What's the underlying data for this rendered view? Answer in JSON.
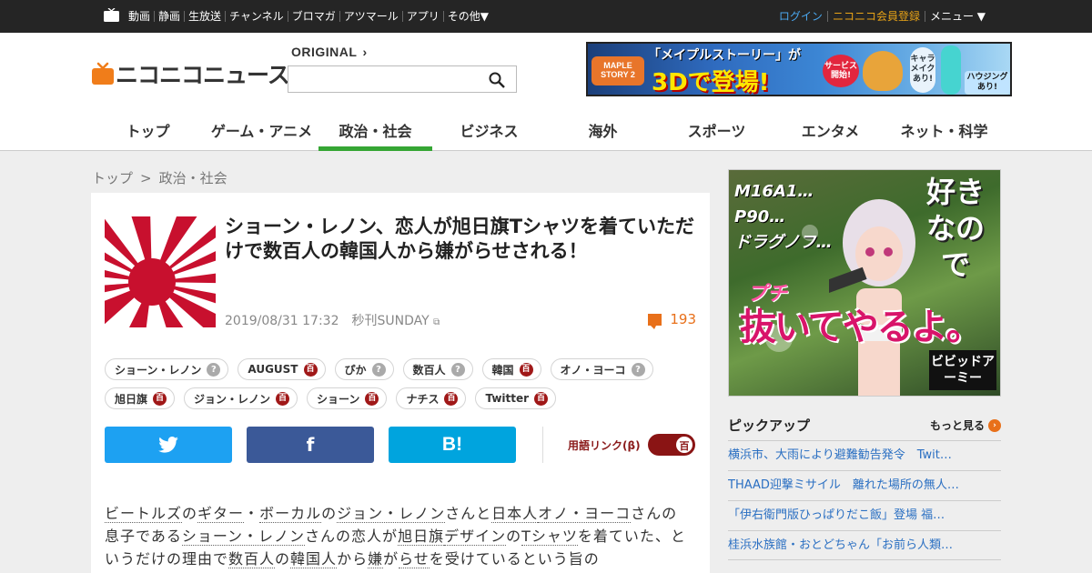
{
  "topbar": {
    "nav": [
      "動画",
      "静画",
      "生放送",
      "チャンネル",
      "ブロマガ",
      "アツマール",
      "アプリ",
      "その他▼"
    ],
    "login": "ログイン",
    "register": "ニコニコ会員登録",
    "menu": "メニュー ▼"
  },
  "header": {
    "logo_text": "ニコニコニュース",
    "original_label": "ORIGINAL",
    "search_value": ""
  },
  "ad_top": {
    "logo": "MAPLE STORY 2",
    "line1": "「メイプルストーリー」が",
    "line2": "3Dで登場!",
    "service": "サービス開始!",
    "chara": "キャラメイクあり!",
    "housing": "ハウジングあり!"
  },
  "nav": [
    {
      "label": "トップ",
      "active": false
    },
    {
      "label": "ゲーム・アニメ",
      "active": false
    },
    {
      "label": "政治・社会",
      "active": true
    },
    {
      "label": "ビジネス",
      "active": false
    },
    {
      "label": "海外",
      "active": false
    },
    {
      "label": "スポーツ",
      "active": false
    },
    {
      "label": "エンタメ",
      "active": false
    },
    {
      "label": "ネット・科学",
      "active": false
    }
  ],
  "breadcrumb": {
    "home": "トップ",
    "sep": ">",
    "current": "政治・社会"
  },
  "article": {
    "title": "ショーン・レノン、恋人が旭日旗Tシャツを着ていただけで数百人の韓国人から嫌がらせされる！",
    "date": "2019/08/31 17:32",
    "source": "秒刊SUNDAY",
    "comment_count": "193",
    "tags": [
      {
        "label": "ショーン・レノン",
        "type": "q"
      },
      {
        "label": "AUGUST",
        "type": "h"
      },
      {
        "label": "ぴか",
        "type": "q"
      },
      {
        "label": "数百人",
        "type": "q"
      },
      {
        "label": "韓国",
        "type": "h"
      },
      {
        "label": "オノ・ヨーコ",
        "type": "q"
      },
      {
        "label": "旭日旗",
        "type": "h"
      },
      {
        "label": "ジョン・レノン",
        "type": "h"
      },
      {
        "label": "ショーン",
        "type": "h"
      },
      {
        "label": "ナチス",
        "type": "h"
      },
      {
        "label": "Twitter",
        "type": "h"
      }
    ],
    "tag_q_icon": "?",
    "tag_h_icon": "百",
    "share": {
      "twitter": "twitter-icon",
      "facebook": "f",
      "hatena": "B!"
    },
    "term_link_label": "用語リンク(β)",
    "term_toggle": "百",
    "body_segments": [
      {
        "t": "ビートルズ",
        "k": true
      },
      {
        "t": "の",
        "k": false
      },
      {
        "t": "ギター",
        "k": true
      },
      {
        "t": "・",
        "k": false
      },
      {
        "t": "ボーカル",
        "k": true
      },
      {
        "t": "の",
        "k": false
      },
      {
        "t": "ジョン・レノン",
        "k": true
      },
      {
        "t": "さんと",
        "k": false
      },
      {
        "t": "日本人",
        "k": true
      },
      {
        "t": "オノ・ヨーコ",
        "k": true
      },
      {
        "t": "さんの息子である",
        "k": false
      },
      {
        "t": "ショーン・レノン",
        "k": true
      },
      {
        "t": "さんの恋人が",
        "k": false
      },
      {
        "t": "旭日旗",
        "k": true
      },
      {
        "t": "デザイン",
        "k": true
      },
      {
        "t": "の",
        "k": false
      },
      {
        "t": "Tシャツ",
        "k": true
      },
      {
        "t": "を着ていた、というだけの理由で",
        "k": false
      },
      {
        "t": "数百人",
        "k": true
      },
      {
        "t": "の",
        "k": false
      },
      {
        "t": "韓国人",
        "k": true
      },
      {
        "t": "から",
        "k": false
      },
      {
        "t": "嫌",
        "k": true
      },
      {
        "t": "が",
        "k": false
      },
      {
        "t": "らせ",
        "k": true
      },
      {
        "t": "を受けているという旨の",
        "k": false
      }
    ]
  },
  "ad_side": {
    "labels": [
      "M16A1…",
      "P90…",
      "ドラグノフ…"
    ],
    "like": "好きなので",
    "puchi": "プチ",
    "nuite": "抜いてやるよ。",
    "brand": "ビビッドアーミー"
  },
  "pickup": {
    "title": "ピックアップ",
    "more": "もっと見る",
    "items": [
      "横浜市、大雨により避難勧告発令　Twit…",
      "THAAD迎撃ミサイル　離れた場所の無人…",
      "「伊右衛門版ひっぱりだこ飯」登場 福…",
      "桂浜水族館・おとどちゃん「お前ら人類…"
    ]
  }
}
